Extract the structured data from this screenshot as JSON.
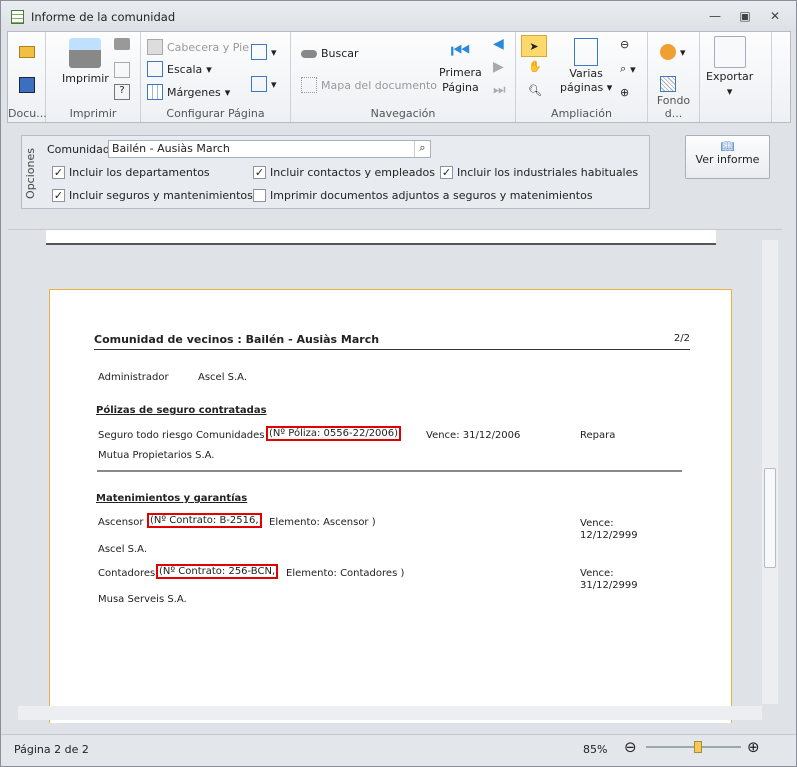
{
  "window": {
    "title": "Informe de la comunidad",
    "minimize": "—",
    "restore": "▣",
    "close": "✕"
  },
  "ribbon": {
    "groups": [
      "Docu...",
      "Imprimir",
      "Configurar Página",
      "Navegación",
      "Ampliación",
      "Fondo d...",
      "Exportar"
    ],
    "print": "Imprimir",
    "header_footer": "Cabecera y Pie",
    "scale": "Escala",
    "margins": "Márgenes",
    "search": "Buscar",
    "doc_map": "Mapa del documento",
    "first_page": "Primera\nPágina",
    "first_page_1": "Primera",
    "first_page_2": "Página",
    "multi_pages_1": "Varias",
    "multi_pages_2": "páginas",
    "export": "Exportar"
  },
  "options": {
    "label": "Opciones",
    "community_label": "Comunidad:",
    "community_value": "Bailén - Ausiàs March",
    "checks": [
      {
        "label": "Incluir los departamentos",
        "checked": true
      },
      {
        "label": "Incluir contactos y empleados",
        "checked": true
      },
      {
        "label": "Incluir los industriales habituales",
        "checked": true
      },
      {
        "label": "Incluir seguros y mantenimientos",
        "checked": true
      },
      {
        "label": "Imprimir documentos adjuntos a seguros y matenimientos",
        "checked": false
      }
    ],
    "view_report": "Ver informe"
  },
  "report": {
    "title": "Comunidad de vecinos : Bailén - Ausiàs March",
    "page": "2/2",
    "admin_label": "Administrador",
    "admin_value": "Ascel S.A.",
    "insurance_heading": "Pólizas de seguro contratadas",
    "insurance": {
      "name": "Seguro todo riesgo Comunidades",
      "policy": "(Nº Póliza: 0556-22/2006)",
      "expires": "Vence: 31/12/2006",
      "type": "Repara",
      "company": "Mutua Propietarios S.A."
    },
    "maint_heading": "Matenimientos y garantías",
    "maint": [
      {
        "name": "Ascensor",
        "contract": "(Nº Contrato: B-2516,",
        "element": "Elemento: Ascensor )",
        "expires_label": "Vence:",
        "expires": "12/12/2999",
        "company": "Ascel S.A."
      },
      {
        "name": "Contadores",
        "contract": "(Nº Contrato: 256-BCN,",
        "element": "Elemento: Contadores )",
        "expires_label": "Vence:",
        "expires": "31/12/2999",
        "company": "Musa Serveis S.A."
      }
    ]
  },
  "status": {
    "page": "Página 2 de 2",
    "zoom": "85%",
    "zoom_fraction": 0.55
  }
}
